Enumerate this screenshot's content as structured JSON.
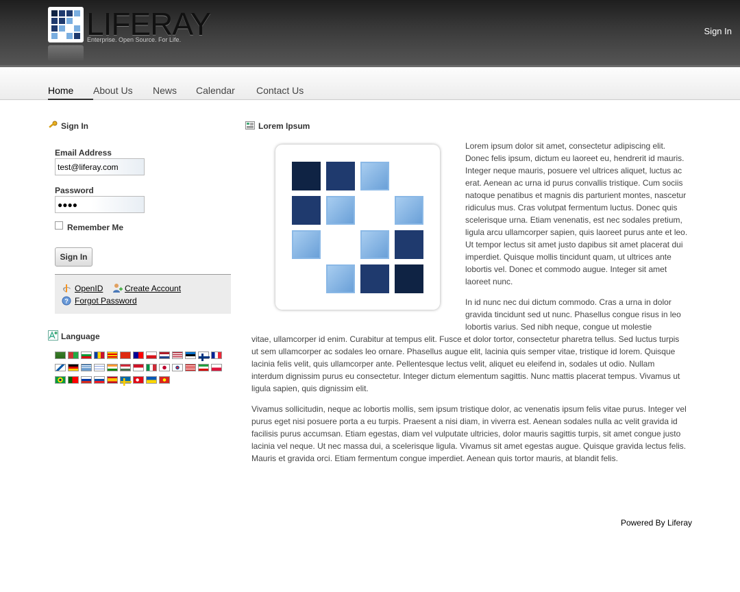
{
  "header": {
    "logo_text": "LIFERAY",
    "logo_tagline": "Enterprise. Open Source. For Life.",
    "sign_in_link": "Sign In"
  },
  "nav": {
    "items": [
      "Home",
      "About Us",
      "News",
      "Calendar",
      "Contact Us"
    ],
    "selected": "Home"
  },
  "login": {
    "title": "Sign In",
    "email_label": "Email Address",
    "email_value": "test@liferay.com",
    "password_label": "Password",
    "password_value": "●●●●",
    "remember_label": "Remember Me",
    "button": "Sign In",
    "openid": "OpenID",
    "create_account": "Create Account",
    "forgot_password": "Forgot Password"
  },
  "language": {
    "title": "Language"
  },
  "content": {
    "title": "Lorem Ipsum",
    "p1": "Lorem ipsum dolor sit amet, consectetur adipiscing elit. Donec felis ipsum, dictum eu laoreet eu, hendrerit id mauris. Integer neque mauris, posuere vel ultrices aliquet, luctus ac erat. Aenean ac urna id purus convallis tristique. Cum sociis natoque penatibus et magnis dis parturient montes, nascetur ridiculus mus. Cras volutpat fermentum luctus. Donec quis scelerisque urna. Etiam venenatis, est nec sodales pretium, ligula arcu ullamcorper sapien, quis laoreet purus ante et leo. Ut tempor lectus sit amet justo dapibus sit amet placerat dui imperdiet. Quisque mollis tincidunt quam, ut ultrices ante lobortis vel. Donec et commodo augue. Integer sit amet laoreet nunc.",
    "p2a": "In id nunc nec dui dictum commodo. Cras a urna in dolor gravida tincidunt sed ut nunc. Phasellus congue risus in leo lobortis varius. Sed nibh neque, congue ut molestie",
    "p2b": "vitae, ullamcorper id enim. Curabitur at tempus elit. Fusce et dolor tortor, consectetur pharetra tellus. Sed luctus turpis ut sem ullamcorper ac sodales leo ornare. Phasellus augue elit, lacinia quis semper vitae, tristique id lorem. Quisque lacinia felis velit, quis ullamcorper ante. Pellentesque lectus velit, aliquet eu eleifend in, sodales ut odio. Nullam interdum dignissim purus eu consectetur. Integer dictum elementum sagittis. Nunc mattis placerat tempus. Vivamus ut ligula sapien, quis dignissim elit.",
    "p3": "Vivamus sollicitudin, neque ac lobortis mollis, sem ipsum tristique dolor, ac venenatis ipsum felis vitae purus. Integer vel purus eget nisi posuere porta a eu turpis. Praesent a nisi diam, in viverra est. Aenean sodales nulla ac velit gravida id facilisis purus accumsan. Etiam egestas, diam vel vulputate ultricies, dolor mauris sagittis turpis, sit amet congue justo lacinia vel neque. Ut nec massa dui, a scelerisque ligula. Vivamus sit amet egestas augue. Quisque gravida lectus felis. Mauris et gravida orci. Etiam fermentum congue imperdiet. Aenean quis tortor mauris, at blandit felis."
  },
  "footer": {
    "text": "Powered By Liferay"
  },
  "colors": {
    "dark_navy": "#0f2344",
    "navy": "#1f3a6e",
    "light_blue": "#7aaee0"
  }
}
